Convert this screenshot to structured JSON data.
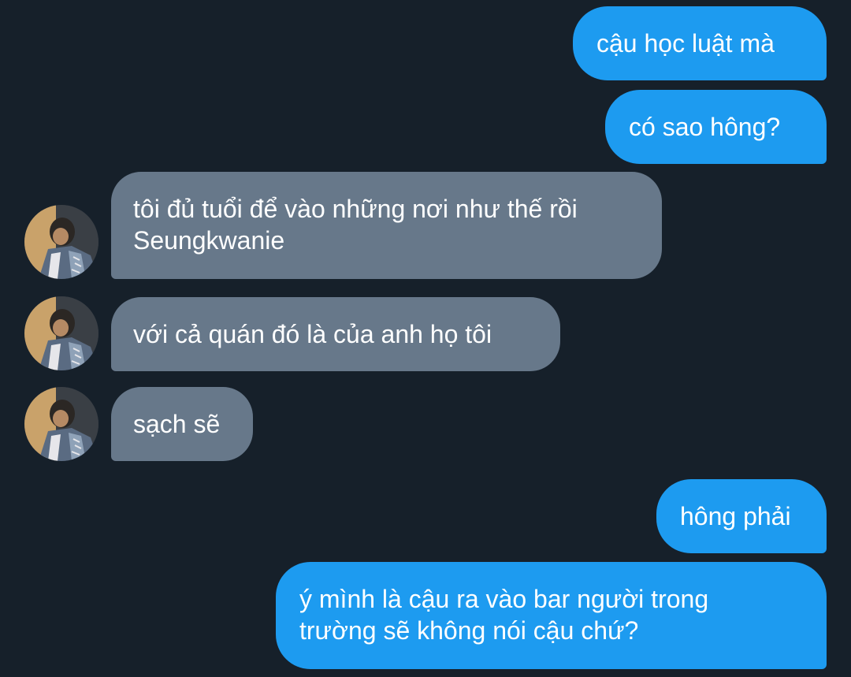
{
  "conversation": {
    "messages": [
      {
        "from": "me",
        "text": "cậu học luật mà"
      },
      {
        "from": "me",
        "text": "có sao hông?"
      },
      {
        "from": "them",
        "lines": [
          "tôi đủ tuổi để vào những nơi như thế rồi",
          "Seungkwanie"
        ]
      },
      {
        "from": "them",
        "text": "với cả quán đó là của anh họ tôi"
      },
      {
        "from": "them",
        "text": "sạch sẽ"
      },
      {
        "from": "me",
        "text": "hông phải"
      },
      {
        "from": "me",
        "lines": [
          "ý mình là cậu ra vào bar người trong",
          "trường sẽ không nói cậu chứ?"
        ]
      }
    ]
  },
  "colors": {
    "background": "#16202a",
    "outgoing_bubble": "#1d9bf0",
    "incoming_bubble": "#67788a",
    "text": "#ffffff"
  },
  "icons": {
    "avatar": "contact-avatar-photo"
  }
}
